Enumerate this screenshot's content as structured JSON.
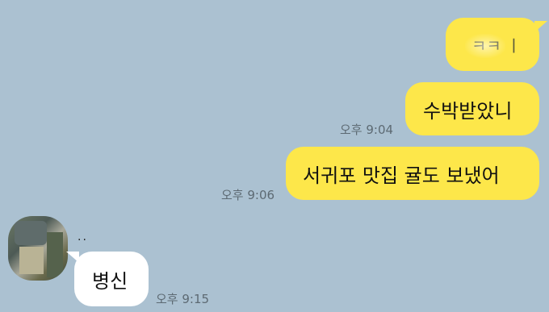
{
  "colors": {
    "background": "#abc1d1",
    "my_bubble": "#fde74a",
    "their_bubble": "#ffffff",
    "time_text": "#5d6a73"
  },
  "messages": [
    {
      "sender": "me",
      "text": "ㅋㅋ ㅣ",
      "time": ""
    },
    {
      "sender": "me",
      "text": "수박받았니",
      "time": "오후 9:04"
    },
    {
      "sender": "me",
      "text": "서귀포 맛집 귤도 보냈어",
      "time": "오후 9:06"
    },
    {
      "sender": "other",
      "name": "..",
      "text": "병신",
      "time": "오후 9:15"
    }
  ]
}
